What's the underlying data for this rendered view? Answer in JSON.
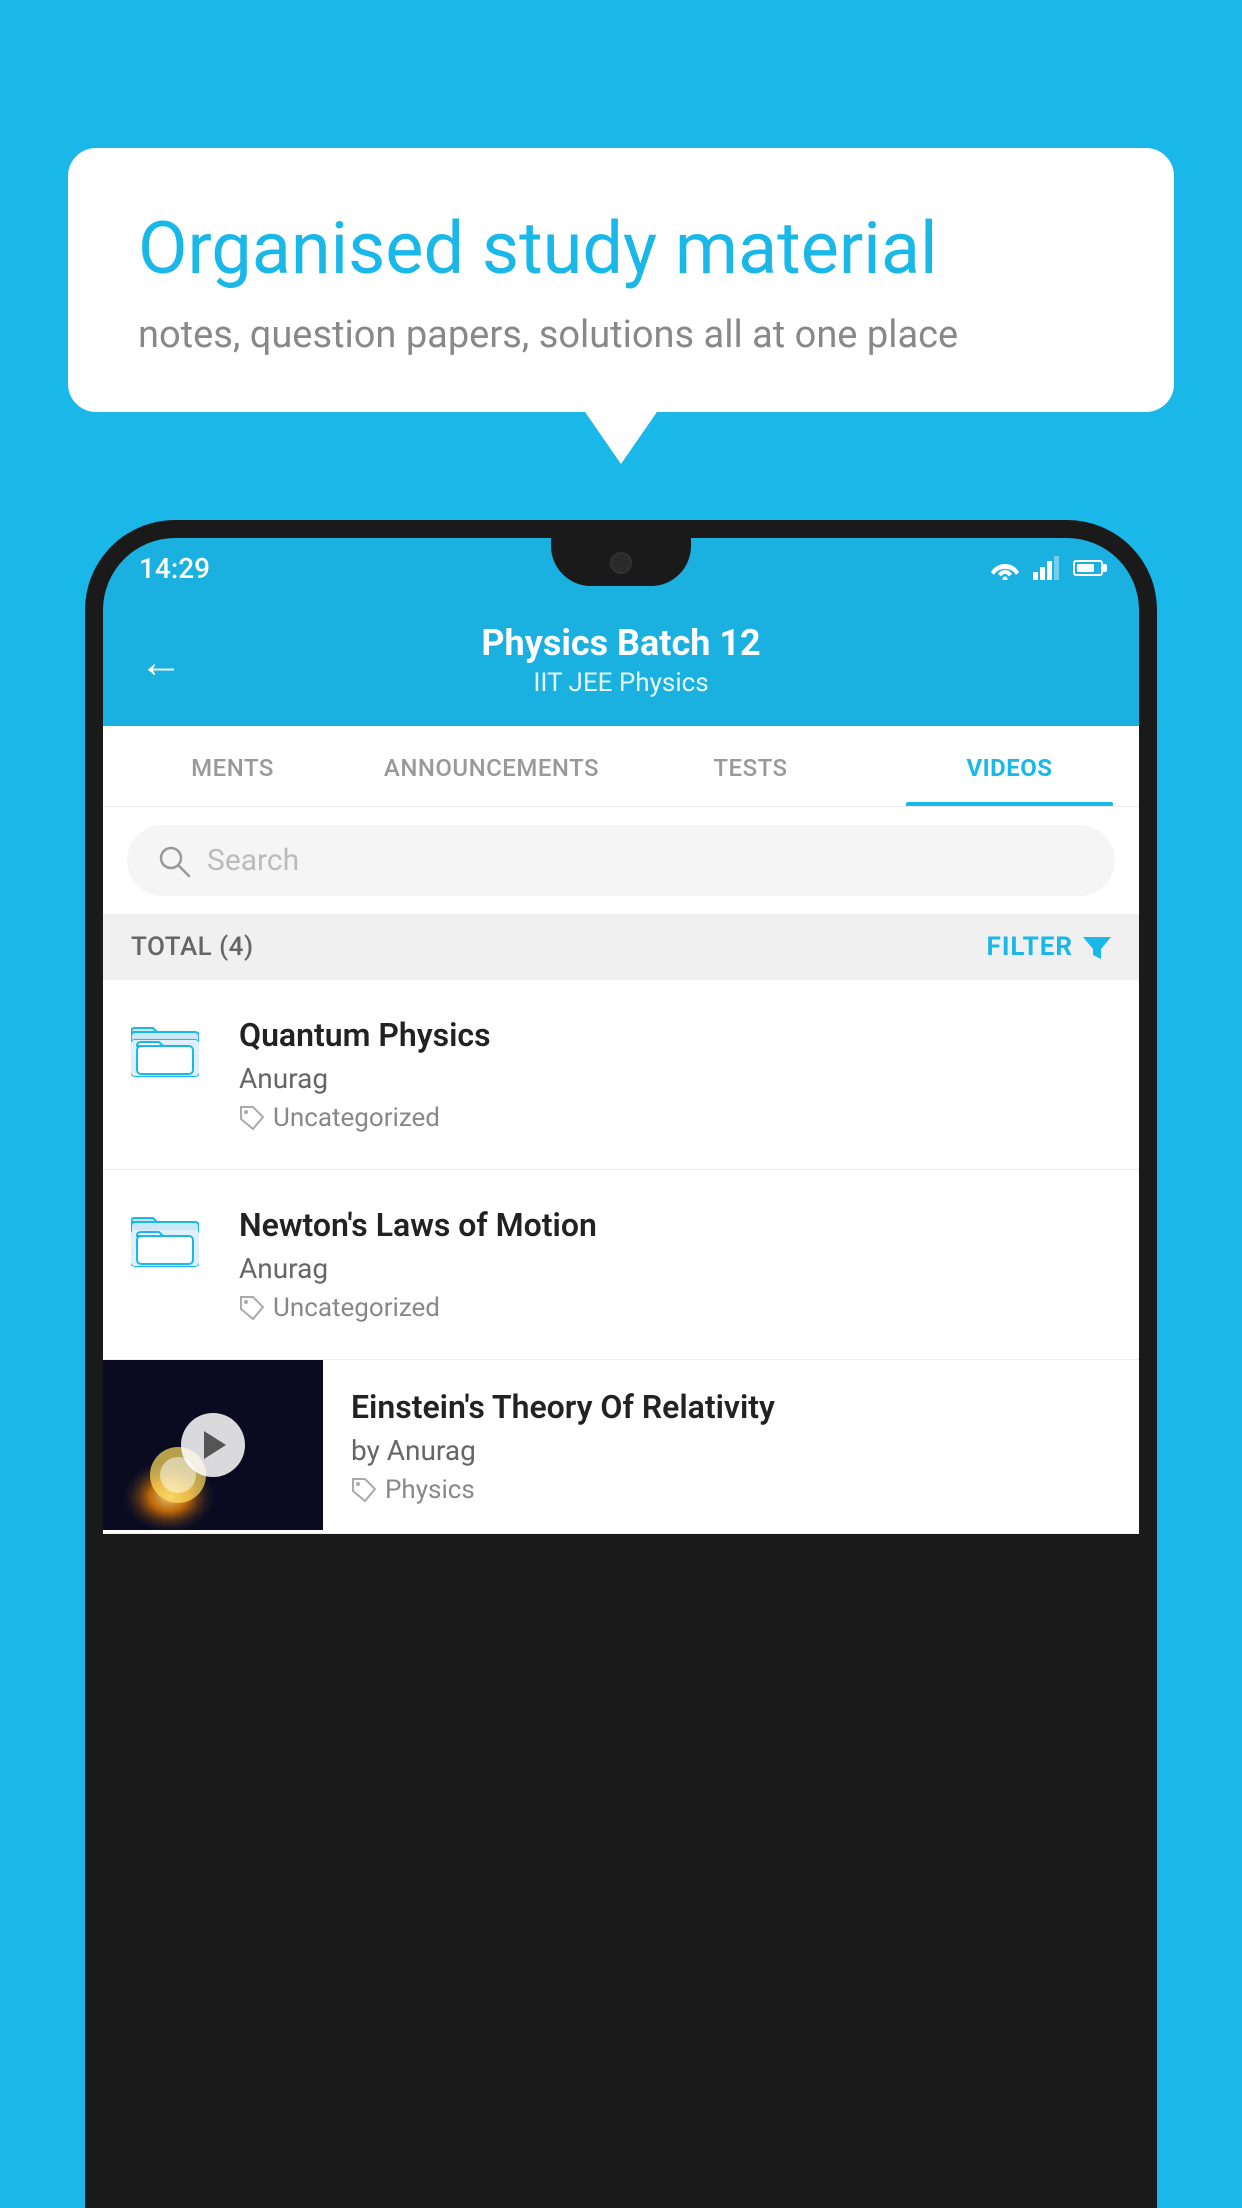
{
  "background_color": "#1ab8e8",
  "speech_bubble": {
    "heading": "Organised study material",
    "subtext": "notes, question papers, solutions all at one place"
  },
  "phone": {
    "status_bar": {
      "time": "14:29"
    },
    "header": {
      "title": "Physics Batch 12",
      "subtitle": "IIT JEE   Physics",
      "back_label": "←"
    },
    "tabs": [
      {
        "label": "MENTS",
        "active": false
      },
      {
        "label": "ANNOUNCEMENTS",
        "active": false
      },
      {
        "label": "TESTS",
        "active": false
      },
      {
        "label": "VIDEOS",
        "active": true
      }
    ],
    "search": {
      "placeholder": "Search"
    },
    "filter_bar": {
      "total_label": "TOTAL (4)",
      "filter_label": "FILTER"
    },
    "video_items": [
      {
        "title": "Quantum Physics",
        "author": "Anurag",
        "tag": "Uncategorized",
        "type": "folder"
      },
      {
        "title": "Newton's Laws of Motion",
        "author": "Anurag",
        "tag": "Uncategorized",
        "type": "folder"
      },
      {
        "title": "Einstein's Theory Of Relativity",
        "author": "by Anurag",
        "tag": "Physics",
        "type": "video"
      }
    ]
  }
}
